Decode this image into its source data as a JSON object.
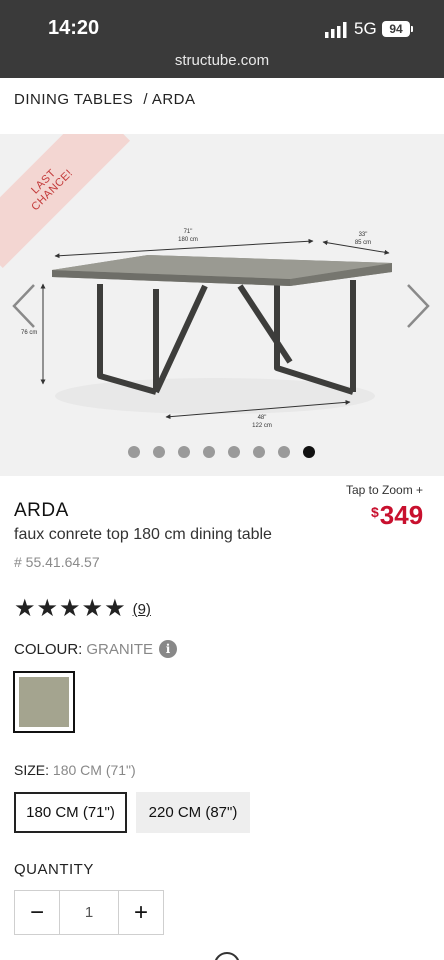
{
  "status_bar": {
    "time": "14:20",
    "network": "5G",
    "battery": "94",
    "url": "structube.com"
  },
  "breadcrumb": {
    "items": [
      "DINING TABLES",
      "ARDA"
    ],
    "separator": "/"
  },
  "hero": {
    "badge": "LAST CHANCE!",
    "dimensions": {
      "length_in": "71\"",
      "length_cm": "180 cm",
      "depth_in": "33\"",
      "depth_cm": "85 cm",
      "height_cm": "76 cm",
      "base_in": "48\"",
      "base_cm": "122 cm"
    },
    "dot_count": 8,
    "active_dot": 8
  },
  "product": {
    "zoom_hint": "Tap to Zoom +",
    "price_currency": "$",
    "price_amount": "349",
    "name": "ARDA",
    "description": "faux conrete top 180 cm dining table",
    "sku": "# 55.41.64.57",
    "rating": 5,
    "review_count": "(9)"
  },
  "colour": {
    "label": "COLOUR:",
    "value": "GRANITE",
    "info": "i",
    "swatch": "#a4a48f"
  },
  "size": {
    "label": "SIZE:",
    "value": "180 CM (71\")",
    "options": [
      "180 CM (71\")",
      "220 CM (87\")"
    ]
  },
  "quantity": {
    "label": "QUANTITY",
    "value": "1",
    "minus": "−",
    "plus": "+"
  },
  "colors": {
    "accent": "#c8102e",
    "status_bar": "#3a3a3a",
    "badge_bg": "#f3d6d2",
    "badge_text": "#c33a3a"
  }
}
